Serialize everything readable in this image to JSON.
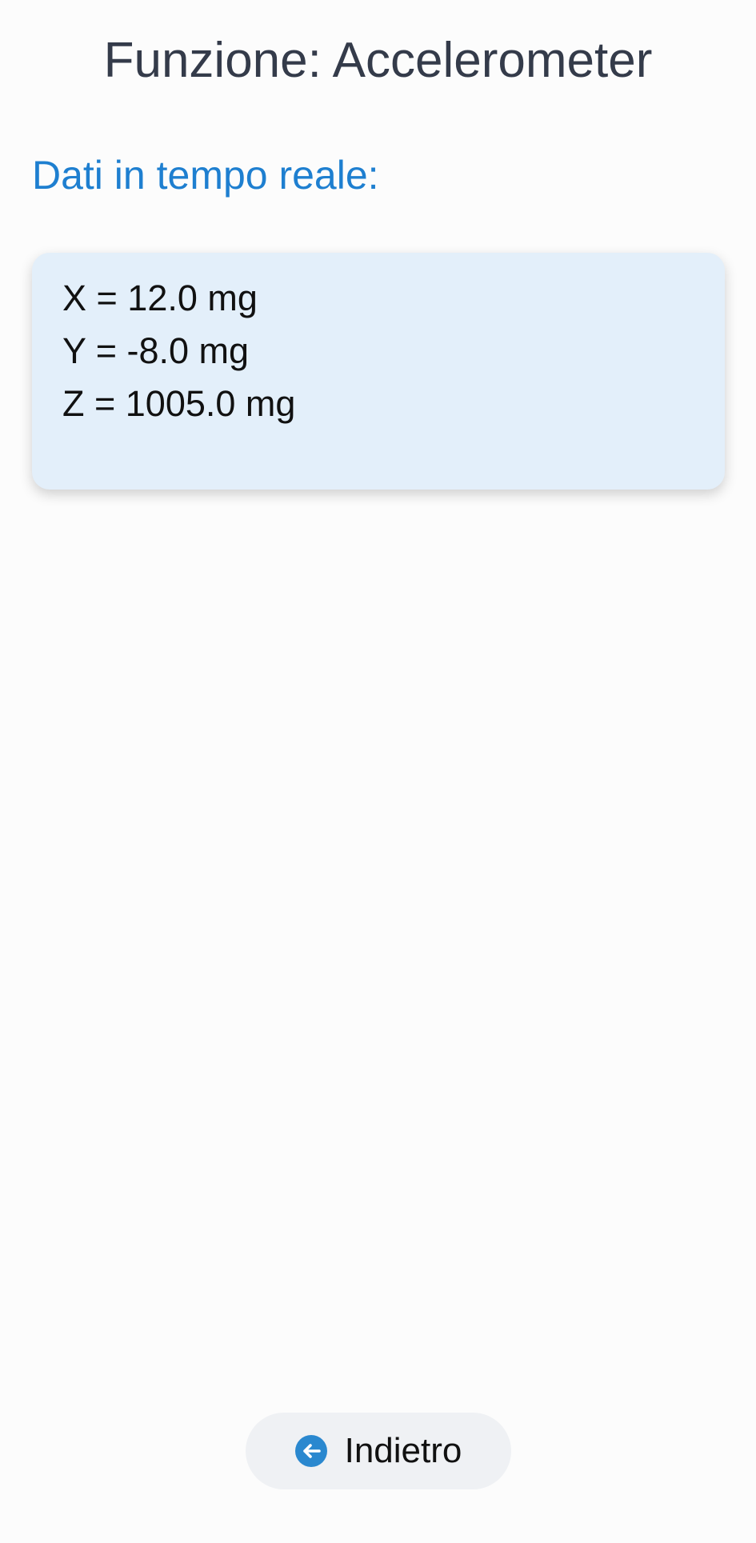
{
  "header": {
    "title": "Funzione: Accelerometer"
  },
  "main": {
    "section_label": "Dati in tempo reale:",
    "readings": [
      "X = 12.0 mg",
      "Y = -8.0 mg",
      "Z = 1005.0 mg"
    ]
  },
  "footer": {
    "back_label": "Indietro",
    "back_icon": "arrow-left-circle-icon"
  },
  "colors": {
    "title": "#343b4a",
    "accent": "#1e7fd0",
    "card_background": "#e3effa",
    "button_background": "#eff1f4"
  }
}
